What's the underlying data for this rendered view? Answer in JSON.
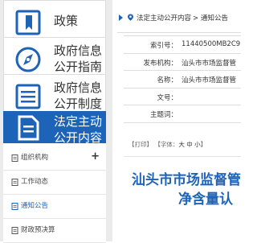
{
  "sidebar": {
    "nav": [
      {
        "label_lines": [
          "政策"
        ],
        "icon": "book-icon"
      },
      {
        "label_lines": [
          "政府信息",
          "公开指南"
        ],
        "icon": "compass-icon"
      },
      {
        "label_lines": [
          "政府信息",
          "公开制度"
        ],
        "icon": "list-icon"
      },
      {
        "label_lines": [
          "法定主动",
          "公开内容"
        ],
        "icon": "document-icon",
        "active": true
      }
    ],
    "sub_items": [
      {
        "label": "组织机构",
        "expander": "+"
      },
      {
        "label": "工作动态"
      },
      {
        "label": "通知公告",
        "selected": true
      },
      {
        "label": "财政预决算"
      }
    ]
  },
  "breadcrumb": {
    "items": [
      "法定主动公开内容",
      "通知公告"
    ],
    "separator": ">"
  },
  "info": [
    {
      "key": "索引号：",
      "value": "11440500MB2C9"
    },
    {
      "key": "发布机构：",
      "value": "汕头市市场监督管"
    },
    {
      "key": "名称：",
      "value": "汕头市市场监督管"
    },
    {
      "key": "文号：",
      "value": ""
    },
    {
      "key": "主题词：",
      "value": ""
    }
  ],
  "tools": {
    "print": "【打印】",
    "font_prefix": "【字体：",
    "large": "大",
    "medium": "中",
    "small": "小",
    "font_suffix": "】"
  },
  "document": {
    "title_line1": "汕头市市场监督管",
    "title_line2": "净含量认"
  },
  "colors": {
    "accent": "#1d63b8",
    "sidebar_bg": "#ebebeb"
  }
}
